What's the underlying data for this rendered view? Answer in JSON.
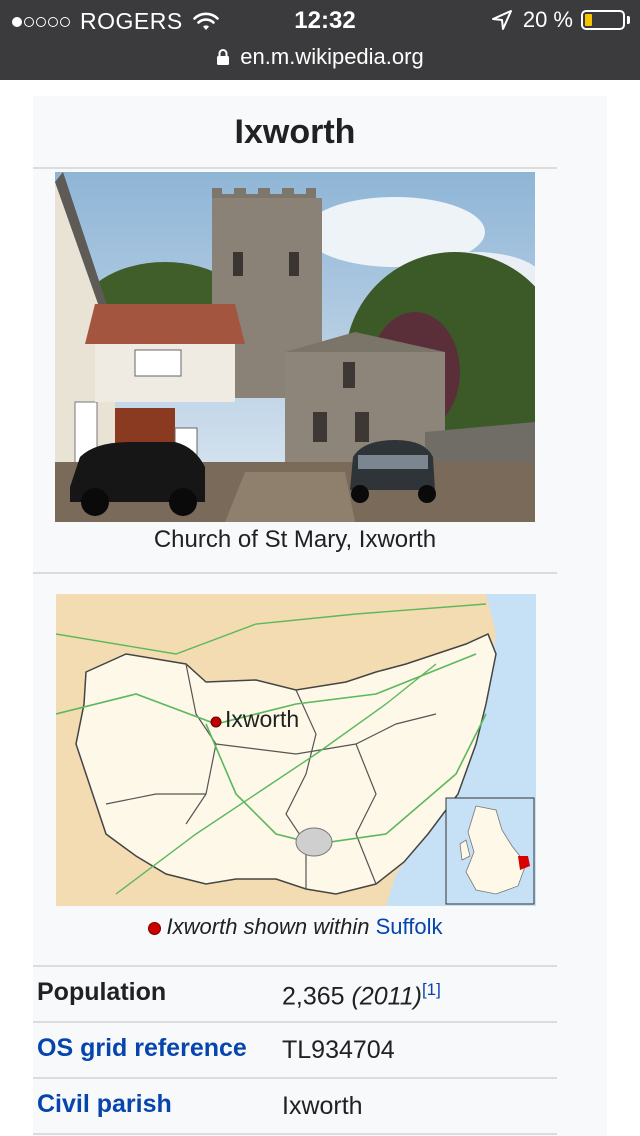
{
  "status_bar": {
    "signal_dots": [
      true,
      false,
      false,
      false,
      false
    ],
    "carrier": "ROGERS",
    "time": "12:32",
    "battery_percent_text": "20 %",
    "battery_level": 0.2
  },
  "url_bar": {
    "url": "en.m.wikipedia.org"
  },
  "infobox": {
    "title": "Ixworth",
    "photo_caption": "Church of St Mary, Ixworth",
    "map_label": "Ixworth",
    "map_caption": {
      "prefix": "Ixworth shown within",
      "link": "Suffolk"
    },
    "rows": [
      {
        "label": "Population",
        "value": "2,365",
        "value_extra": "(2011)",
        "ref": "[1]"
      },
      {
        "label": "OS grid reference",
        "value": "TL934704"
      },
      {
        "label": "Civil parish",
        "value": "Ixworth"
      }
    ]
  },
  "colors": {
    "status_bar_bg": "#3b3b3d",
    "battery_fill": "#f5c400",
    "link": "#0645ad",
    "infobox_bg": "#f8f9fa"
  },
  "icons": [
    "wifi-icon",
    "location-arrow-icon",
    "battery-icon",
    "lock-icon",
    "map-marker-icon"
  ]
}
